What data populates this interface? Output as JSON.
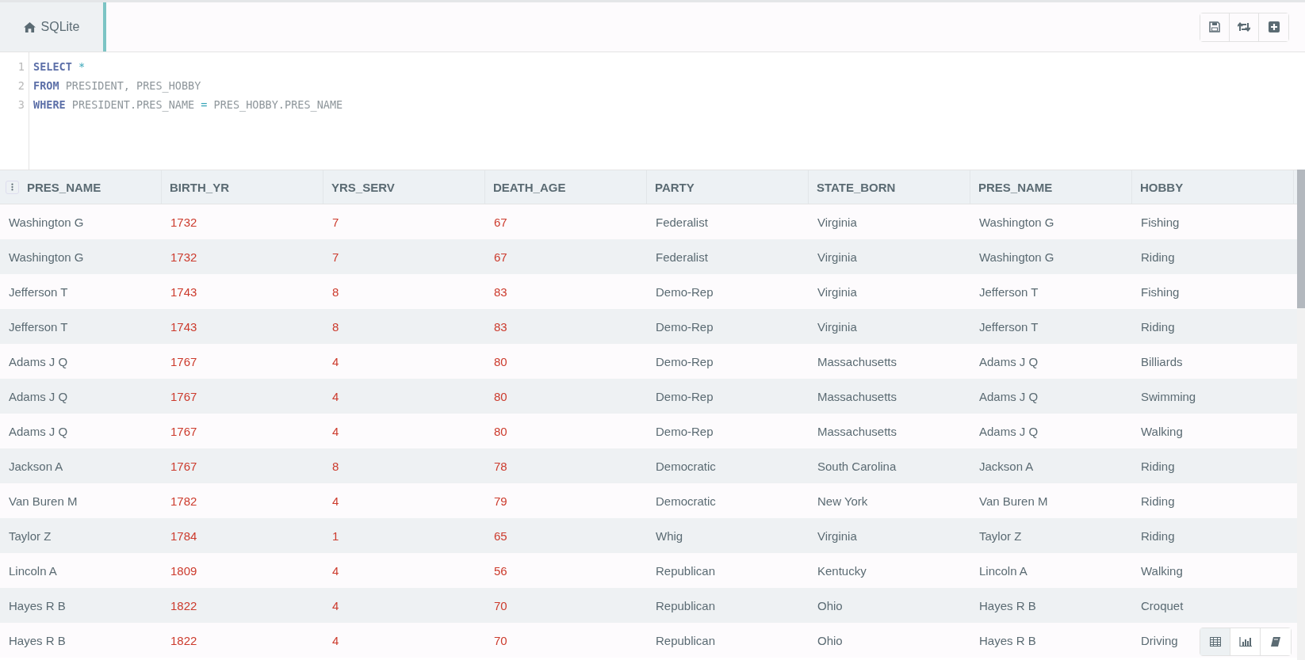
{
  "tabs": [
    {
      "label": "SQLite",
      "selected": true
    }
  ],
  "toolbar": {
    "buttons": [
      {
        "kind": "save"
      },
      {
        "kind": "refresh"
      },
      {
        "kind": "add"
      }
    ]
  },
  "editor": {
    "lines": [
      {
        "number": "1",
        "tokens": [
          {
            "kind": "keyword",
            "text": "SELECT"
          },
          {
            "kind": "op",
            "text": " *"
          }
        ]
      },
      {
        "number": "2",
        "tokens": [
          {
            "kind": "keyword",
            "text": "FROM"
          },
          {
            "kind": "ident",
            "text": " PRESIDENT, PRES_HOBBY"
          }
        ]
      },
      {
        "number": "3",
        "tokens": [
          {
            "kind": "keyword",
            "text": "WHERE"
          },
          {
            "kind": "ident",
            "text": " PRESIDENT.PRES_NAME"
          },
          {
            "kind": "op",
            "text": " ="
          },
          {
            "kind": "ident",
            "text": " PRES_HOBBY.PRES_NAME"
          }
        ]
      }
    ]
  },
  "table": {
    "columns": [
      {
        "label": "PRES_NAME",
        "kind": "text"
      },
      {
        "label": "BIRTH_YR",
        "kind": "number"
      },
      {
        "label": "YRS_SERV",
        "kind": "number"
      },
      {
        "label": "DEATH_AGE",
        "kind": "number"
      },
      {
        "label": "PARTY",
        "kind": "text"
      },
      {
        "label": "STATE_BORN",
        "kind": "text"
      },
      {
        "label": "PRES_NAME",
        "kind": "text"
      },
      {
        "label": "HOBBY",
        "kind": "text"
      }
    ],
    "rows": [
      [
        "Washington G",
        "1732",
        "7",
        "67",
        "Federalist",
        "Virginia",
        "Washington G",
        "Fishing"
      ],
      [
        "Washington G",
        "1732",
        "7",
        "67",
        "Federalist",
        "Virginia",
        "Washington G",
        "Riding"
      ],
      [
        "Jefferson T",
        "1743",
        "8",
        "83",
        "Demo-Rep",
        "Virginia",
        "Jefferson T",
        "Fishing"
      ],
      [
        "Jefferson T",
        "1743",
        "8",
        "83",
        "Demo-Rep",
        "Virginia",
        "Jefferson T",
        "Riding"
      ],
      [
        "Adams J Q",
        "1767",
        "4",
        "80",
        "Demo-Rep",
        "Massachusetts",
        "Adams J Q",
        "Billiards"
      ],
      [
        "Adams J Q",
        "1767",
        "4",
        "80",
        "Demo-Rep",
        "Massachusetts",
        "Adams J Q",
        "Swimming"
      ],
      [
        "Adams J Q",
        "1767",
        "4",
        "80",
        "Demo-Rep",
        "Massachusetts",
        "Adams J Q",
        "Walking"
      ],
      [
        "Jackson A",
        "1767",
        "8",
        "78",
        "Democratic",
        "South Carolina",
        "Jackson A",
        "Riding"
      ],
      [
        "Van Buren M",
        "1782",
        "4",
        "79",
        "Democratic",
        "New York",
        "Van Buren M",
        "Riding"
      ],
      [
        "Taylor Z",
        "1784",
        "1",
        "65",
        "Whig",
        "Virginia",
        "Taylor Z",
        "Riding"
      ],
      [
        "Lincoln A",
        "1809",
        "4",
        "56",
        "Republican",
        "Kentucky",
        "Lincoln A",
        "Walking"
      ],
      [
        "Hayes R B",
        "1822",
        "4",
        "70",
        "Republican",
        "Ohio",
        "Hayes R B",
        "Croquet"
      ],
      [
        "Hayes R B",
        "1822",
        "4",
        "70",
        "Republican",
        "Ohio",
        "Hayes R B",
        "Driving"
      ]
    ]
  },
  "view_switcher": [
    {
      "kind": "table",
      "selected": true
    },
    {
      "kind": "chart",
      "selected": false
    },
    {
      "kind": "notebook",
      "selected": false
    }
  ]
}
